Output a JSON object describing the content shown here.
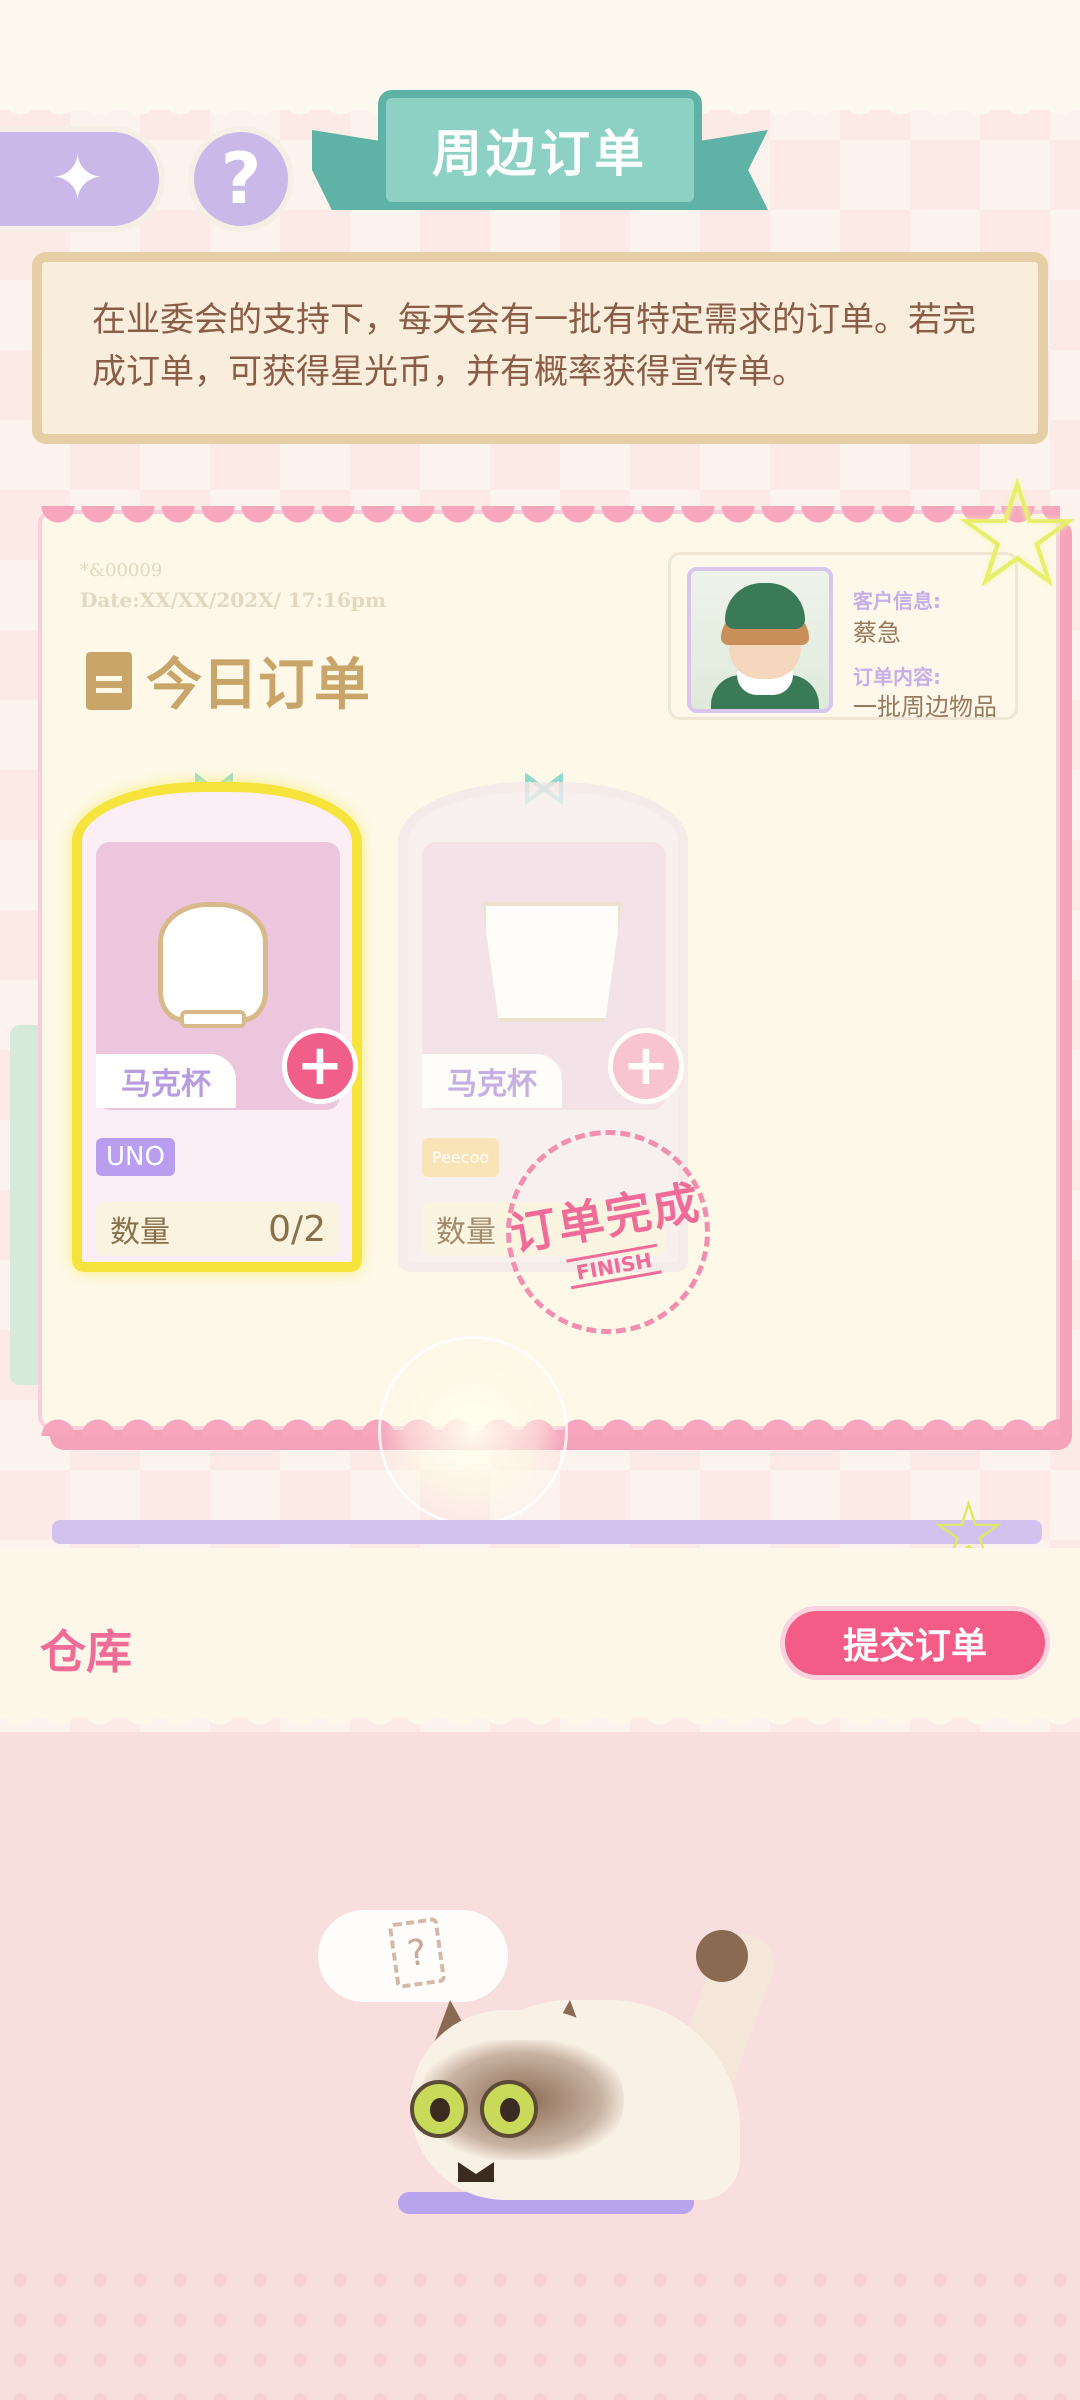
{
  "header": {
    "title": "周边订单",
    "help_symbol": "?",
    "back_symbol": "✦"
  },
  "info": {
    "text": "在业委会的支持下，每天会有一批有特定需求的订单。若完成订单，可获得星光币，并有概率获得宣传单。"
  },
  "order": {
    "code": "*&00009",
    "date": "Date:XX/XX/202X/ 17:16pm",
    "title": "今日订单",
    "client": {
      "info_label": "客户信息:",
      "info_value": "蔡急",
      "content_label": "订单内容:",
      "content_value": "一批周边物品"
    },
    "items": [
      {
        "name": "马克杯",
        "brand": "UNO",
        "qty_label": "数量",
        "qty": "0/2",
        "state": "active"
      },
      {
        "name": "马克杯",
        "brand": "Peecoo",
        "qty_label": "数量",
        "qty": "",
        "state": "finished"
      }
    ],
    "stamp": {
      "main": "订单完成",
      "sub": "FINISH"
    }
  },
  "warehouse": {
    "title": "仓库",
    "submit_label": "提交订单",
    "thought_symbol": "?"
  },
  "colors": {
    "accent_pink": "#f35c86",
    "ribbon_teal": "#8dd1c4",
    "lavender": "#c9b8e8",
    "highlight_yellow": "#f6e33b"
  }
}
